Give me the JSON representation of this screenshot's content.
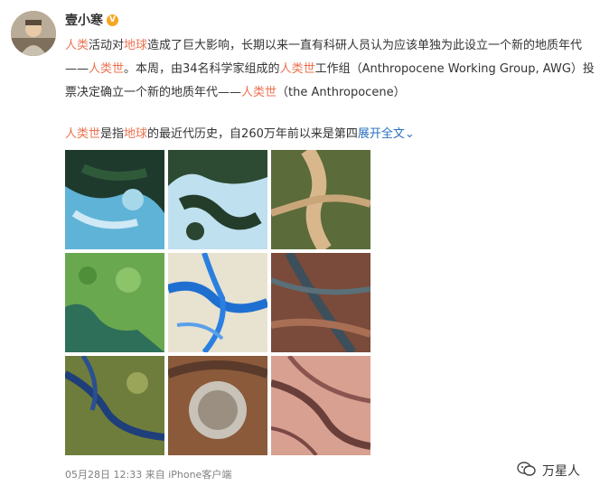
{
  "post": {
    "username": "壹小寒",
    "badge": "V",
    "para1": {
      "s1": "人类",
      "s2": "活动对",
      "s3": "地球",
      "s4": "造成了巨大影响，长期以来一直有科研人员认为应该单独为此设立一个新的地质年代——",
      "s5": "人类世",
      "s6": "。本周，由34名科学家组成的",
      "s7": "人类世",
      "s8": "工作组（Anthropocene Working Group, AWG）投票决定确立一个新的地质年代——",
      "s9": "人类世",
      "s10": "（the Anthropocene）"
    },
    "para2": {
      "s1": "人类世",
      "s2": "是指",
      "s3": "地球",
      "s4": "的最近代历史，自260万年前以来是第四",
      "expand": "展开全文",
      "expand_icon": "chevron-down-icon"
    },
    "timestamp": "05月28日 12:33",
    "source": "来自 iPhone客户端",
    "watermark": "万星人"
  },
  "colors": {
    "highlight": "#eb7350",
    "link": "#2a6fbf",
    "meta": "#808080"
  }
}
